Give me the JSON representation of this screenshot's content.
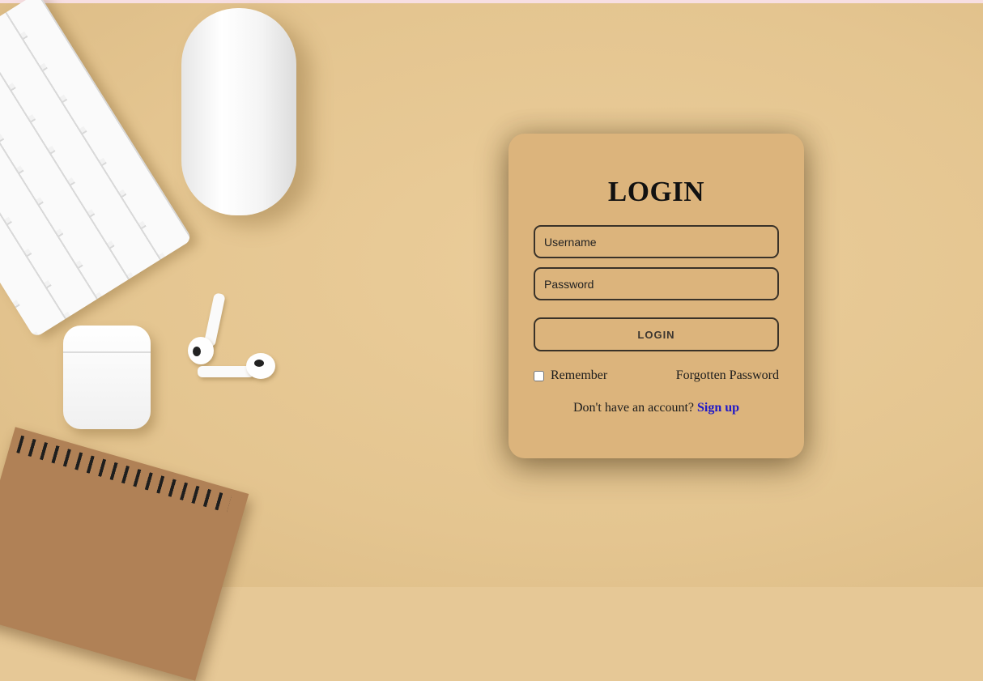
{
  "login_card": {
    "title": "LOGIN",
    "username_placeholder": "Username",
    "password_placeholder": "Password",
    "login_button": "LOGIN",
    "remember_label": "Remember",
    "remember_checked": false,
    "forgot_link": "Forgotten Password",
    "signup_prompt": "Don't have an account?",
    "signup_link": "Sign up"
  },
  "colors": {
    "background": "#e6c896",
    "card": "#dcb47c",
    "border": "#3a3228",
    "link": "#1f18c8",
    "top_strip": "#f7dfe2"
  }
}
